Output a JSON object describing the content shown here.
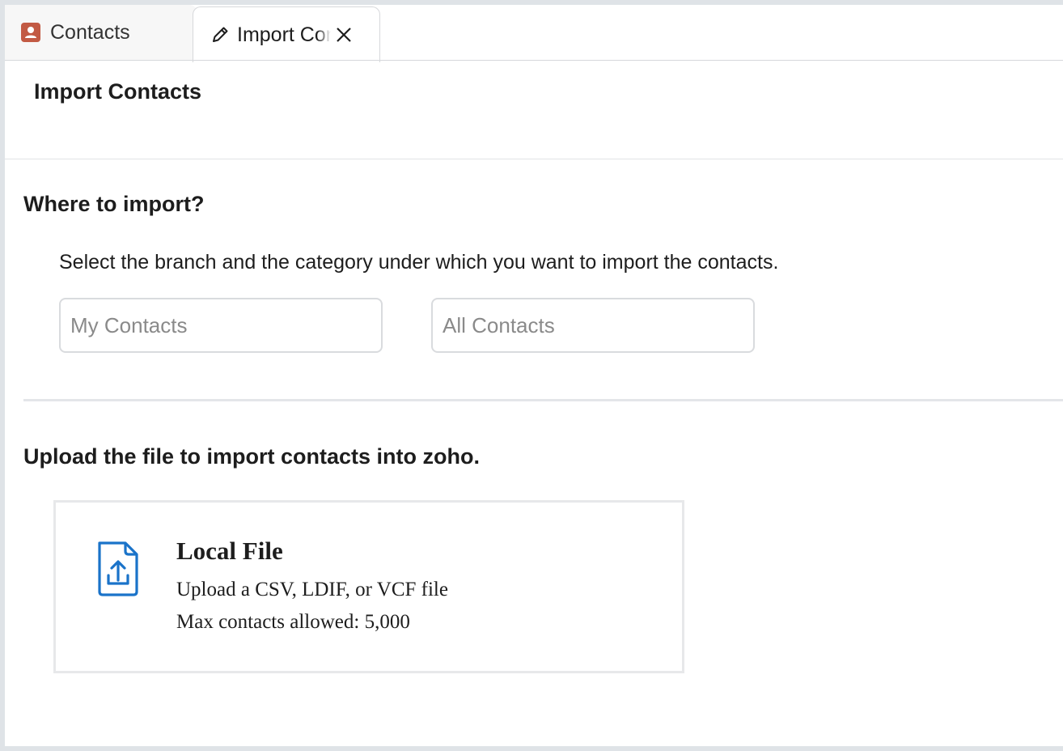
{
  "tabs": [
    {
      "label": "Contacts",
      "icon": "contacts-icon",
      "active": false
    },
    {
      "label": "Import Contacts",
      "icon": "pencil-icon",
      "active": true
    }
  ],
  "page": {
    "title": "Import Contacts"
  },
  "where_to_import": {
    "title": "Where to import?",
    "instruction": "Select the branch and the category under which you want to import the contacts.",
    "branch_placeholder": "My Contacts",
    "category_placeholder": "All Contacts"
  },
  "upload": {
    "title": "Upload the file to import contacts into zoho.",
    "card": {
      "icon": "file-upload-icon",
      "title": "Local File",
      "description": "Upload a CSV, LDIF, or VCF file",
      "limit": "Max contacts allowed: 5,000"
    }
  },
  "colors": {
    "contacts_icon": "#c25a44",
    "upload_icon": "#1a73c9",
    "border": "#d9dbde"
  }
}
